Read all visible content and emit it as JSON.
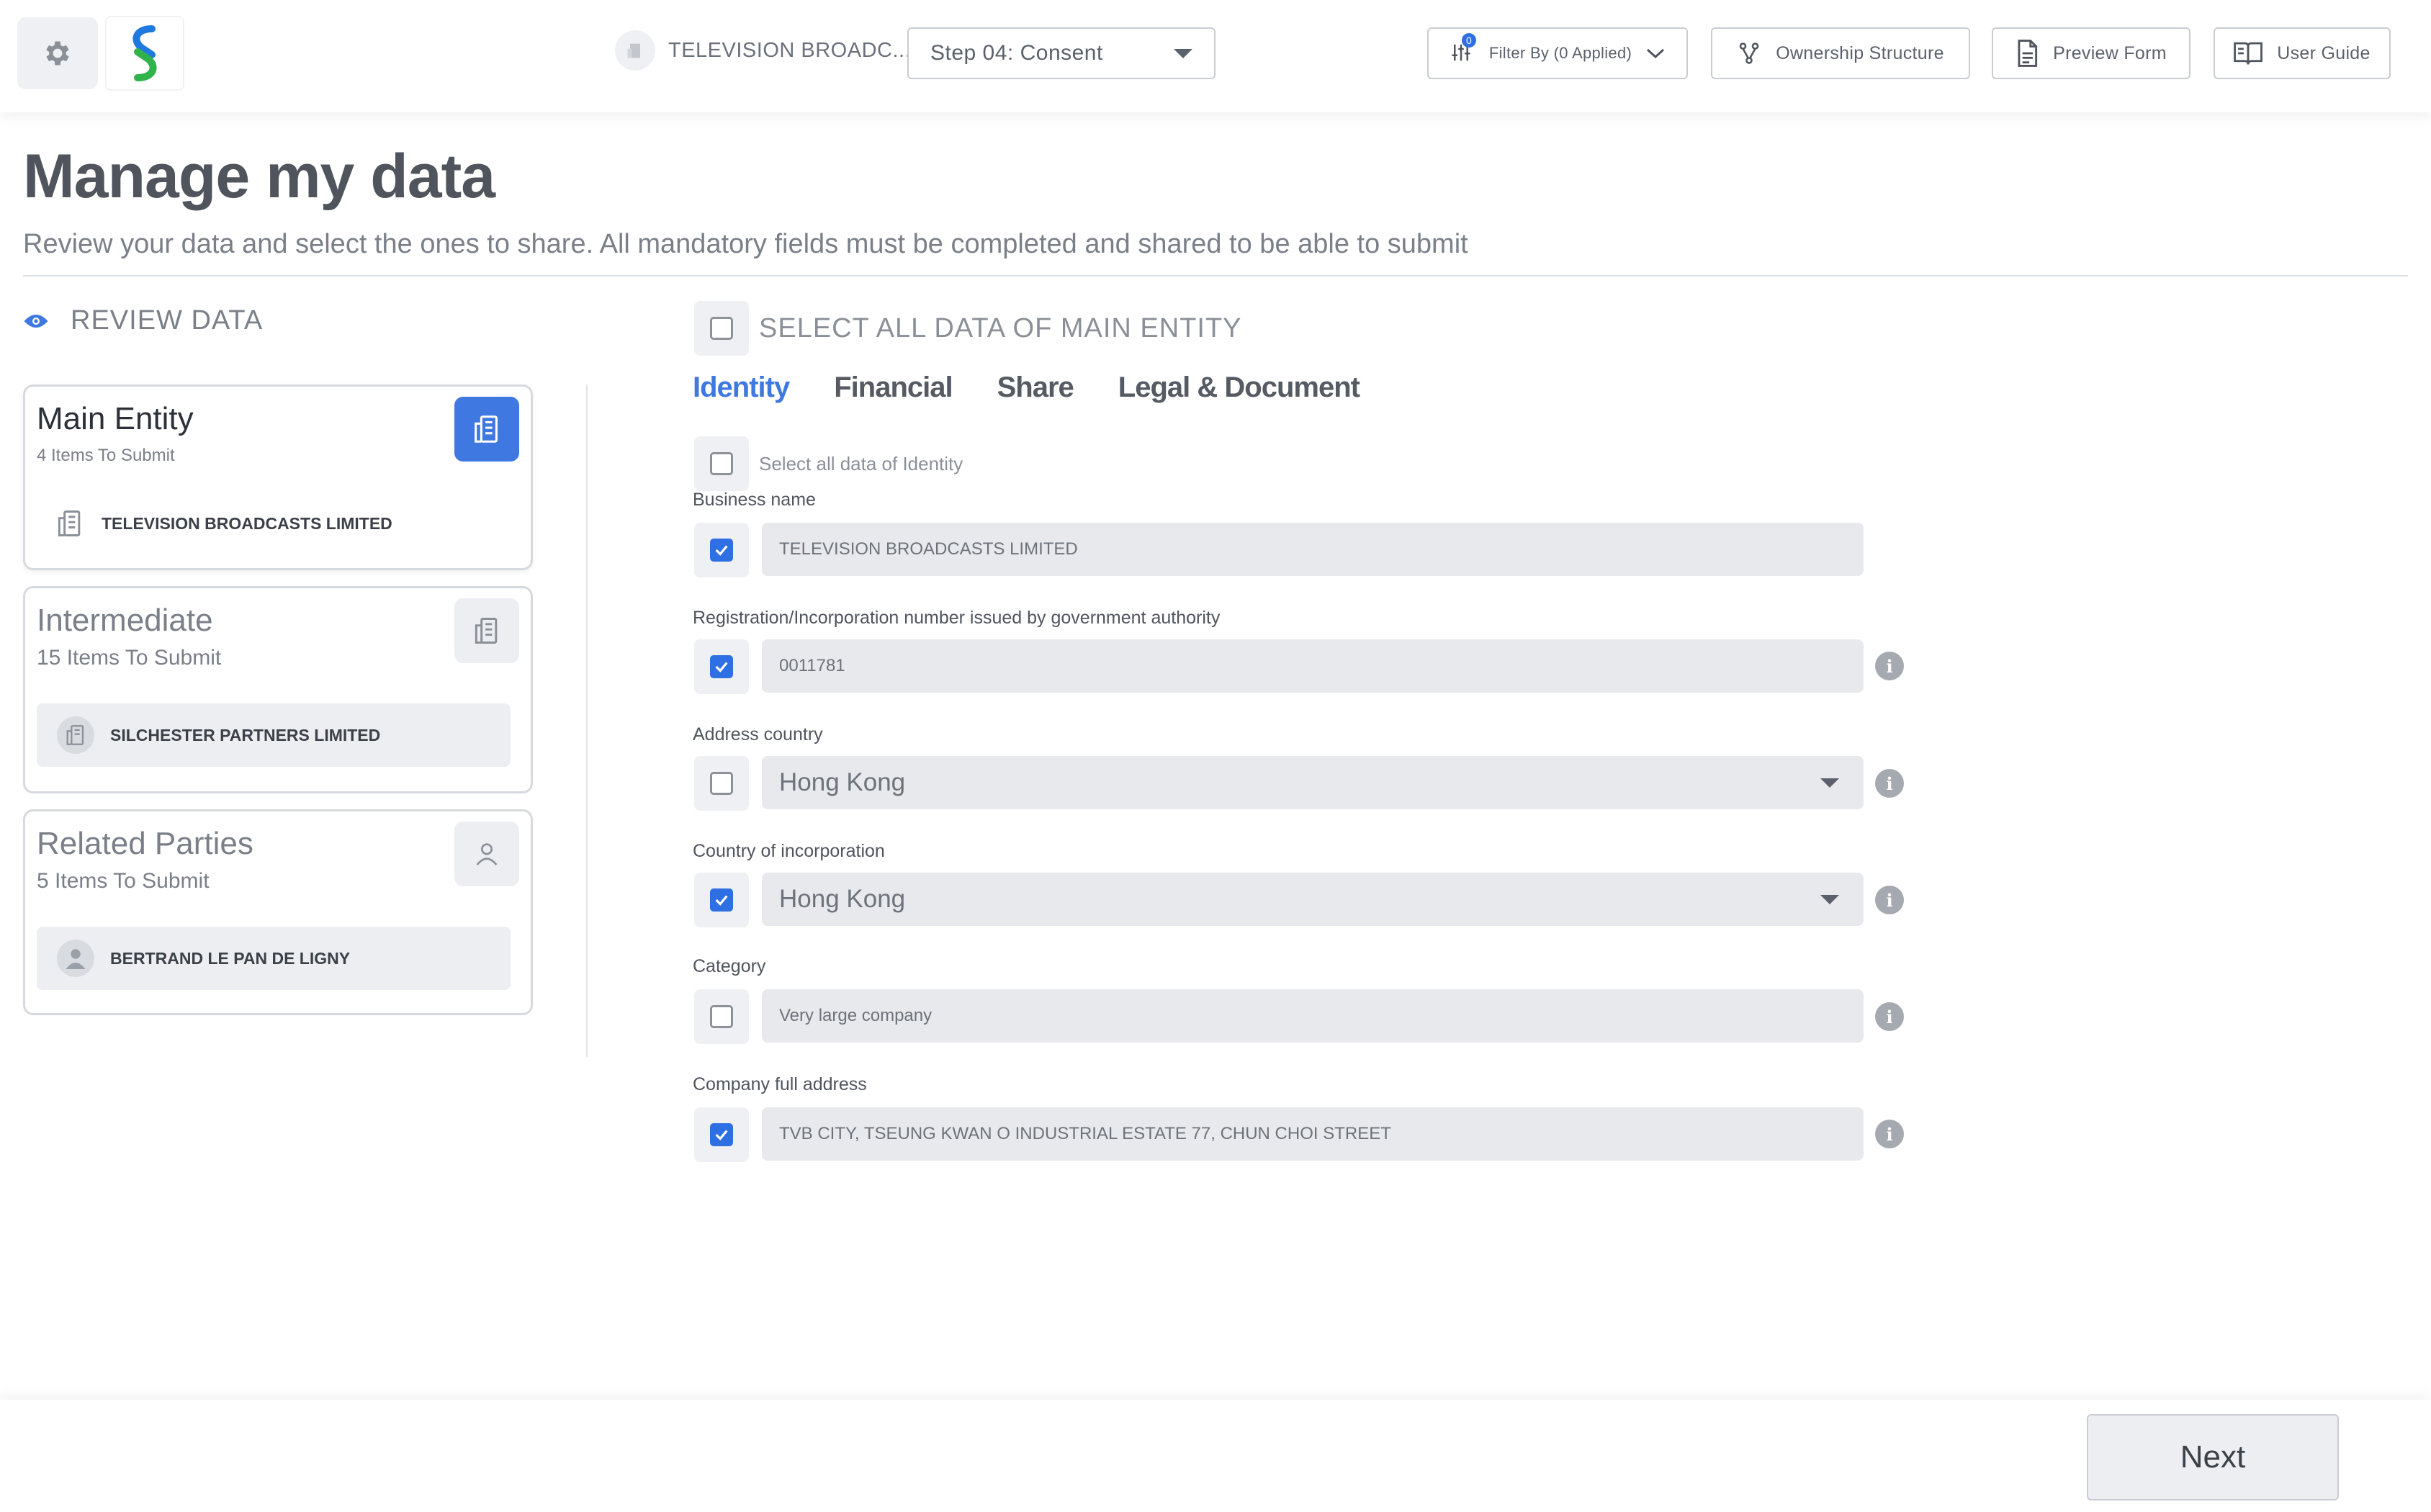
{
  "topbar": {
    "entity_name": "TELEVISION BROADC...",
    "step_select": "Step 04: Consent",
    "filter_label": "Filter By (0 Applied)",
    "filter_count": "0",
    "ownership_label": "Ownership Structure",
    "preview_label": "Preview Form",
    "guide_label": "User Guide"
  },
  "header": {
    "title": "Manage my data",
    "subtitle": "Review your data and select the ones to share. All mandatory fields must be completed and shared to be able to submit"
  },
  "sidebar": {
    "review_label": "REVIEW DATA",
    "cards": [
      {
        "title": "Main Entity",
        "count": "4 Items To Submit",
        "item": "TELEVISION BROADCASTS LIMITED"
      },
      {
        "title": "Intermediate",
        "count": "15 Items To Submit",
        "item": "SILCHESTER PARTNERS LIMITED"
      },
      {
        "title": "Related Parties",
        "count": "5 Items To Submit",
        "item": "BERTRAND LE PAN DE LIGNY"
      }
    ]
  },
  "main": {
    "select_all_main": "SELECT ALL DATA OF MAIN ENTITY",
    "tabs": [
      "Identity",
      "Financial",
      "Share",
      "Legal & Document"
    ],
    "active_tab": "Identity",
    "select_all_identity": "Select all data of Identity",
    "fields": [
      {
        "label": "Business name",
        "value": "TELEVISION BROADCASTS LIMITED",
        "checked": true
      },
      {
        "label": "Registration/Incorporation number issued by government authority",
        "value": "0011781",
        "checked": true
      },
      {
        "label": "Address country",
        "value": "Hong Kong",
        "checked": false
      },
      {
        "label": "Country of incorporation",
        "value": "Hong Kong",
        "checked": true
      },
      {
        "label": "Category",
        "value": "Very large company",
        "checked": false
      },
      {
        "label": "Company full address",
        "value": "TVB CITY, TSEUNG KWAN O INDUSTRIAL ESTATE 77, CHUN CHOI STREET",
        "checked": true
      }
    ]
  },
  "footer": {
    "next_label": "Next"
  },
  "colors": {
    "accent": "#2f6fe4",
    "field_bg": "#e8e9ec",
    "text": "#4f545d"
  }
}
